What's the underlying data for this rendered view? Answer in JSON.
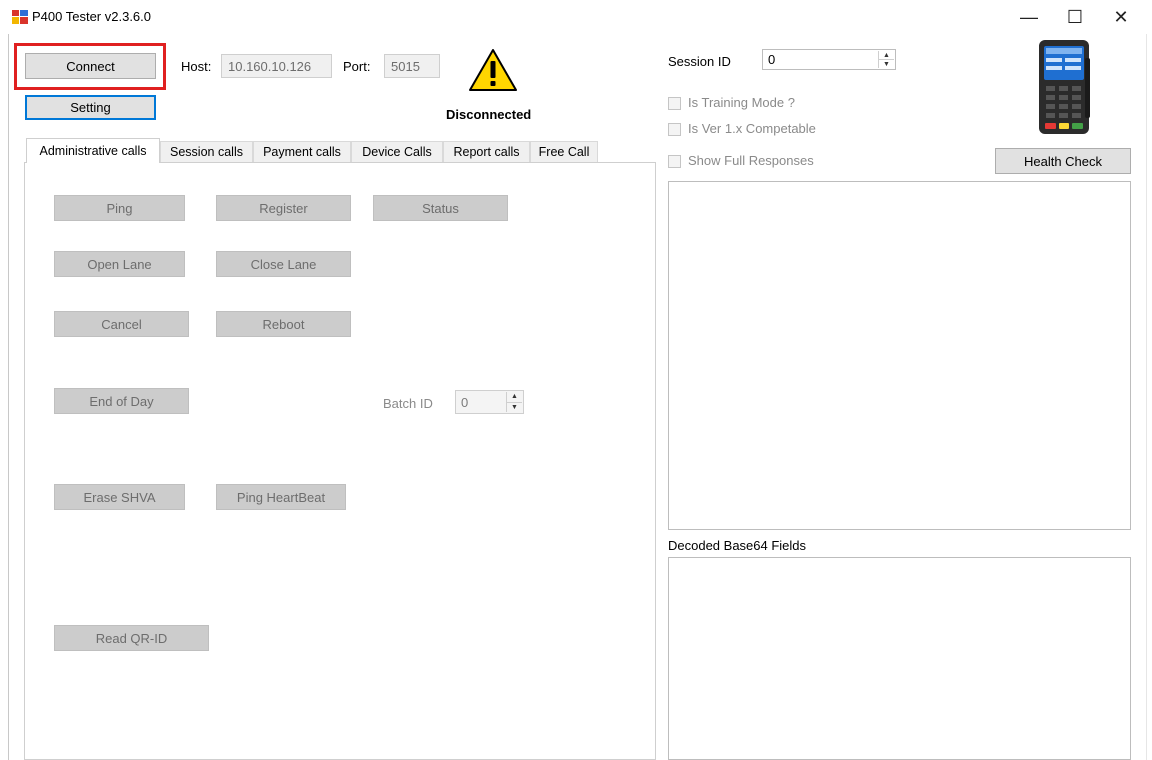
{
  "window": {
    "title": "P400 Tester  v2.3.6.0",
    "controls": {
      "minimize": "—",
      "maximize": "☐",
      "close": "✕"
    }
  },
  "connection": {
    "connect_label": "Connect",
    "setting_label": "Setting",
    "host_label": "Host:",
    "host_value": "10.160.10.126",
    "port_label": "Port:",
    "port_value": "5015",
    "status_text": "Disconnected",
    "warning_icon": "!"
  },
  "tabs": [
    {
      "label": "Administrative calls",
      "active": true
    },
    {
      "label": "Session calls"
    },
    {
      "label": "Payment calls"
    },
    {
      "label": "Device Calls"
    },
    {
      "label": "Report calls"
    },
    {
      "label": "Free Call"
    }
  ],
  "admin_panel": {
    "ping": "Ping",
    "register": "Register",
    "status": "Status",
    "open_lane": "Open Lane",
    "close_lane": "Close Lane",
    "cancel": "Cancel",
    "reboot": "Reboot",
    "end_of_day": "End of Day",
    "batch_id_label": "Batch ID",
    "batch_id_value": "0",
    "erase_shva": "Erase SHVA",
    "ping_heartbeat": "Ping HeartBeat",
    "read_qr_id": "Read QR-ID"
  },
  "session": {
    "session_id_label": "Session ID",
    "session_id_value": "0",
    "is_training_mode": "Is Training Mode ?",
    "is_ver_compatible": "Is Ver 1.x Competable",
    "show_full_responses": "Show Full Responses",
    "health_check": "Health Check"
  },
  "output": {
    "decoded_label": "Decoded Base64 Fields"
  },
  "colors": {
    "highlight_red": "#e02020",
    "focus_blue": "#0078d7",
    "warning_yellow": "#ffd600"
  }
}
